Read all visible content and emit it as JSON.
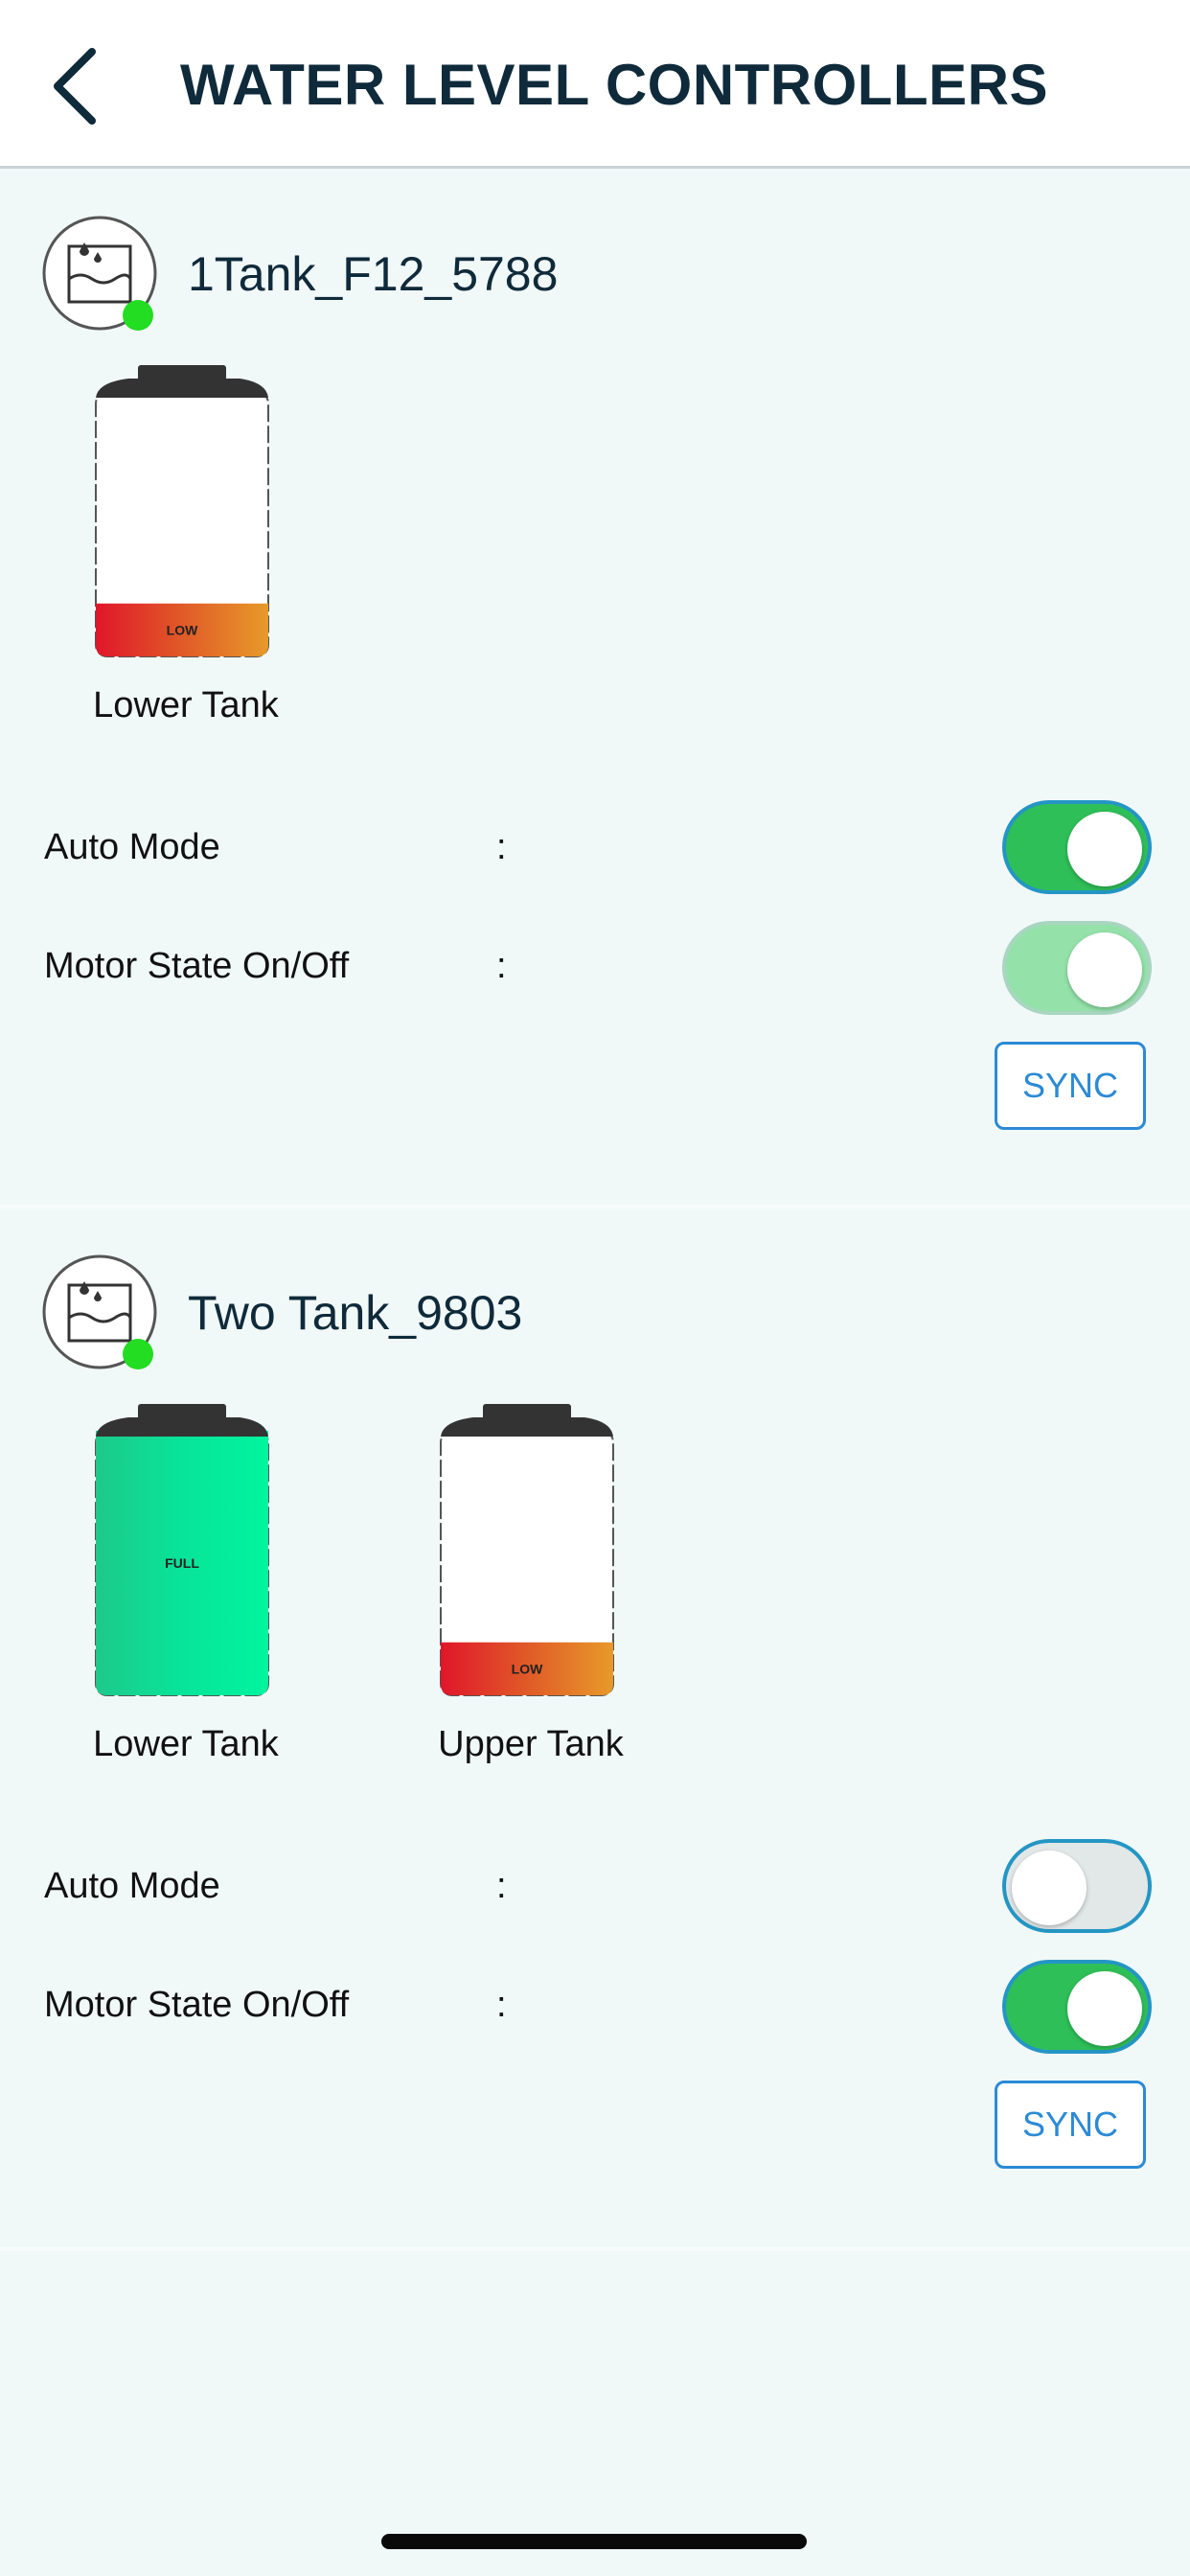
{
  "header": {
    "title": "WATER LEVEL CONTROLLERS",
    "back_icon": "chevron-left-icon"
  },
  "devices": [
    {
      "name": "1Tank_F12_5788",
      "icon": "water-tank-icon",
      "online_color": "#22dd22",
      "tanks": [
        {
          "label": "Lower Tank",
          "level_text": "LOW",
          "level_fraction": 0.2
        }
      ],
      "auto_mode": {
        "label": "Auto Mode",
        "colon": ":",
        "state": "on"
      },
      "motor_state": {
        "label": "Motor State On/Off",
        "colon": ":",
        "state": "on-disabled"
      },
      "sync_label": "SYNC"
    },
    {
      "name": "Two Tank_9803",
      "icon": "water-tank-icon",
      "online_color": "#22dd22",
      "tanks": [
        {
          "label": "Lower Tank",
          "level_text": "FULL",
          "level_fraction": 1.0
        },
        {
          "label": "Upper Tank",
          "level_text": "LOW",
          "level_fraction": 0.2
        }
      ],
      "auto_mode": {
        "label": "Auto Mode",
        "colon": ":",
        "state": "off"
      },
      "motor_state": {
        "label": "Motor State On/Off",
        "colon": ":",
        "state": "on"
      },
      "sync_label": "SYNC"
    }
  ],
  "colors": {
    "toggle_on": "#2fbf58",
    "toggle_border": "#2496c4",
    "sync_blue": "#2b8ad6",
    "low_gradient": [
      "#e0162b",
      "#e79a2a"
    ],
    "full_gradient": [
      "#1ec98a",
      "#00f59e"
    ],
    "tank_cap": "#333333"
  }
}
